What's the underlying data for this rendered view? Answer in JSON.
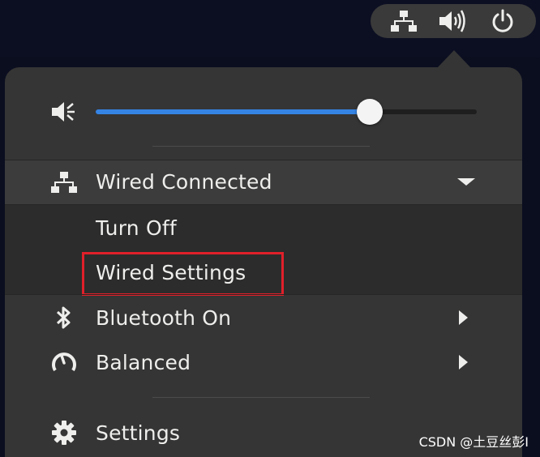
{
  "topbar": {
    "icons": [
      "network-wired-icon",
      "volume-icon",
      "power-icon"
    ]
  },
  "volume": {
    "level_percent": 72,
    "icon": "speaker-icon"
  },
  "menu": {
    "wired": {
      "label": "Wired Connected",
      "icon": "network-wired-icon",
      "expanded": true,
      "submenu": [
        {
          "label": "Turn Off"
        },
        {
          "label": "Wired Settings",
          "highlighted": true
        }
      ]
    },
    "bluetooth": {
      "label": "Bluetooth On",
      "icon": "bluetooth-icon"
    },
    "power_mode": {
      "label": "Balanced",
      "icon": "power-profile-icon"
    },
    "settings": {
      "label": "Settings",
      "icon": "gear-icon"
    }
  },
  "colors": {
    "accent": "#3584e4",
    "panel": "#353535",
    "highlight": "#e0202a"
  },
  "watermark": "CSDN @土豆丝彭I"
}
